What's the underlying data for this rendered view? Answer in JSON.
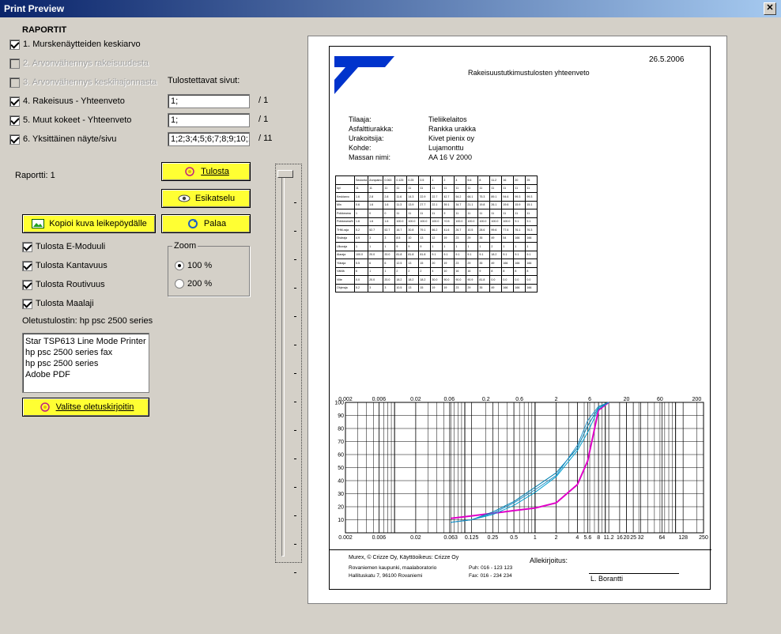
{
  "window": {
    "title": "Print Preview"
  },
  "reports": {
    "heading": "RAPORTIT",
    "items": [
      {
        "label": "1. Murskenäytteiden keskiarvo",
        "checked": true,
        "disabled": false
      },
      {
        "label": "2. Arvonvähennys rakeisuudesta",
        "checked": false,
        "disabled": true
      },
      {
        "label": "3. Arvonvähennys keskihajonnasta",
        "checked": false,
        "disabled": true
      },
      {
        "label": "4. Rakeisuus - Yhteenveto",
        "checked": true,
        "disabled": false
      },
      {
        "label": "5. Muut kokeet - Yhteenveto",
        "checked": true,
        "disabled": false
      },
      {
        "label": "6. Yksittäinen näyte/sivu",
        "checked": true,
        "disabled": false
      }
    ],
    "pages_label": "Tulostettavat sivut:",
    "pages": [
      {
        "value": "1;",
        "total": "/ 1"
      },
      {
        "value": "1;",
        "total": "/ 1"
      },
      {
        "value": "1;2;3;4;5;6;7;8;9;10;1",
        "total": "/ 11"
      }
    ],
    "report_label": "Raportti: 1"
  },
  "buttons": {
    "print": "Tulosta",
    "preview": "Esikatselu",
    "back": "Palaa",
    "copy": "Kopioi kuva leikepöydälle",
    "choose_printer": "Valitse oletuskirjoitin"
  },
  "options": [
    {
      "label": "Tulosta E-Moduuli",
      "checked": true
    },
    {
      "label": "Tulosta Kantavuus",
      "checked": true
    },
    {
      "label": "Tulosta Routivuus",
      "checked": true
    },
    {
      "label": "Tulosta Maalaji",
      "checked": true
    }
  ],
  "zoom": {
    "label": "Zoom",
    "options": [
      {
        "label": "100 %",
        "selected": true
      },
      {
        "label": "200 %",
        "selected": false
      }
    ]
  },
  "printer": {
    "default_label": "Oletustulostin: hp psc 2500 series",
    "list": [
      "Star TSP613 Line Mode Printer",
      "hp psc 2500 series fax",
      "hp psc 2500 series",
      "Adobe PDF"
    ]
  },
  "preview": {
    "date": "26.5.2006",
    "title": "Rakeisuustutkimustulosten yhteenveto",
    "info": [
      {
        "key": "Tilaaja:",
        "value": "Tieliikelaitos"
      },
      {
        "key": "Asfalttiurakka:",
        "value": "Rankka urakka"
      },
      {
        "key": "Urakoitsija:",
        "value": "Kivet pienix oy"
      },
      {
        "key": "Kohde:",
        "value": "Lujamonttu"
      },
      {
        "key": "Massan nimi:",
        "value": "AA  16   V 2000"
      }
    ],
    "table": {
      "header": [
        "",
        "Seulonta",
        "Arvopaino",
        "0.063",
        "0.125",
        "0.25",
        "0.5",
        "1",
        "2",
        "4",
        "5.6",
        "8",
        "11.2",
        "16",
        "20",
        "25"
      ],
      "rows": [
        [
          "kpl",
          "11",
          "11",
          "11",
          "11",
          "11",
          "11",
          "11",
          "11",
          "11",
          "11",
          "11",
          "11",
          "11",
          "11",
          "11"
        ],
        [
          "Keskiarvo",
          "1.6",
          "2.8",
          "2.8",
          "11.6",
          "14.3",
          "22.9",
          "22.7",
          "42.7",
          "54.2",
          "66.1",
          "75.3",
          "89.1",
          "94.6",
          "99.3",
          "99.3"
        ],
        [
          "Min",
          "0.6",
          "1.6",
          "1.6",
          "11.3",
          "13.9",
          "27.7",
          "22.1",
          "39.1",
          "34.7",
          "21.1",
          "19.8",
          "26.1",
          "19.6",
          "15.9",
          "15.1"
        ],
        [
          "Poikkeama",
          "1",
          "0",
          "0",
          "11",
          "11",
          "11",
          "11",
          "9",
          "11",
          "11",
          "11",
          "11",
          "11",
          "11",
          "11"
        ],
        [
          "Poikkeama%",
          "1.6",
          "1.6",
          "1.6",
          "100.0",
          "100.0",
          "100.0",
          "100.0",
          "+0.5",
          "100.0",
          "100.0",
          "100.0",
          "100.0",
          "100.0",
          "9.1",
          "9.1"
        ],
        [
          "THM-raja",
          "5.2",
          "52.7",
          "52.7",
          "16.7",
          "30.8",
          "79.1",
          "66.2",
          "41.6",
          "26.7",
          "10.5",
          "28.6",
          "99.6",
          "77.6",
          "76.1",
          "76.3"
        ],
        [
          "Sisäraja",
          "4.9",
          "3",
          "3",
          "8.5",
          "10",
          "13",
          "12",
          "19",
          "23",
          "29",
          "35",
          "49",
          "54",
          "166",
          "166"
        ],
        [
          "Ulkoraja",
          "1",
          "1",
          "1",
          "9",
          "9",
          "9",
          "1",
          "1",
          "1",
          "1",
          "1",
          "2",
          "1",
          "1",
          "1"
        ],
        [
          "Alaraja",
          "100.0",
          "20.0",
          "20.0",
          "81.8",
          "81.8",
          "81.8",
          "9.1",
          "9.1",
          "9.1",
          "9.1",
          "9.1",
          "18.2",
          "9.1",
          "9.1",
          "9.1"
        ],
        [
          "Yläraja",
          "5.5",
          "6",
          "6",
          "12.5",
          "13",
          "15",
          "20",
          "19",
          "23",
          "29",
          "35",
          "49",
          "166",
          "166",
          "166"
        ],
        [
          "Välillä",
          "6",
          "1",
          "1",
          "2",
          "2",
          "2",
          "4",
          "10",
          "16",
          "16",
          "9",
          "8",
          "8",
          "8",
          "8"
        ],
        [
          "Viite",
          "0.0",
          "20.0",
          "20.0",
          "18.2",
          "18.2",
          "18.2",
          "30.0",
          "90.0",
          "90.0",
          "90.9",
          "81.8",
          "0.0",
          "0.0",
          "0.0",
          "0.0"
        ],
        [
          "Ohjeraja",
          "5.2",
          "3",
          "3",
          "10.5",
          "13",
          "15",
          "19",
          "19",
          "23",
          "29",
          "35",
          "49",
          "166",
          "166",
          "166"
        ]
      ]
    },
    "chart_data": {
      "type": "line",
      "x_scale": "log",
      "xlim": [
        0.002,
        250
      ],
      "ylim": [
        0,
        100
      ],
      "top_ticks": [
        "0.002",
        "0.006",
        "0.02",
        "0.06",
        "0.2",
        "0.6",
        "2",
        "6",
        "20",
        "60",
        "200"
      ],
      "bottom_ticks": [
        "0.002",
        "0.006",
        "0.02",
        "0.063",
        "0.125",
        "0.25",
        "0.5",
        "1",
        "2",
        "4",
        "5.6",
        "8",
        "11.2",
        "16",
        "20",
        "25",
        "32",
        "64",
        "128",
        "250"
      ],
      "y_ticks": [
        "100",
        "90",
        "80",
        "70",
        "60",
        "50",
        "40",
        "30",
        "20",
        "10"
      ],
      "series": [
        {
          "color": "#e000c8",
          "x": [
            0.063,
            0.125,
            0.25,
            0.5,
            1,
            2,
            4,
            5.6,
            8,
            11.2
          ],
          "y": [
            11,
            13,
            15,
            17,
            19,
            23,
            37,
            55,
            94,
            100
          ]
        },
        {
          "color": "#00a0d0",
          "x": [
            0.063,
            0.125,
            0.25,
            0.5,
            1,
            2,
            4,
            5.6,
            8,
            11.2
          ],
          "y": [
            8,
            10,
            14,
            21,
            31,
            43,
            63,
            77,
            95,
            100
          ]
        },
        {
          "color": "#0080b0",
          "x": [
            0.063,
            0.125,
            0.25,
            0.5,
            1,
            2,
            4,
            5.6,
            8,
            11.2
          ],
          "y": [
            8,
            10,
            16,
            24,
            35,
            46,
            65,
            82,
            96,
            100
          ]
        },
        {
          "color": "#2090c8",
          "x": [
            0.063,
            0.125,
            0.25,
            0.5,
            1,
            2,
            4,
            5.6,
            8,
            11.2
          ],
          "y": [
            8,
            10,
            15,
            23,
            33,
            44,
            67,
            86,
            97,
            100
          ]
        }
      ]
    },
    "footer": {
      "company": "Murex, © Crizze Oy, Käyttöoikeus: Crizze Oy",
      "address1": "Rovaniemen kaupunki, maalaboratorio",
      "address2": "Hallituskatu 7, 96100 Rovaniemi",
      "phone": "Puh: 016 - 123 123",
      "fax": "Fax: 016 - 234 234",
      "signature_label": "Allekirjoitus:",
      "signer": "L. Borantti"
    }
  }
}
